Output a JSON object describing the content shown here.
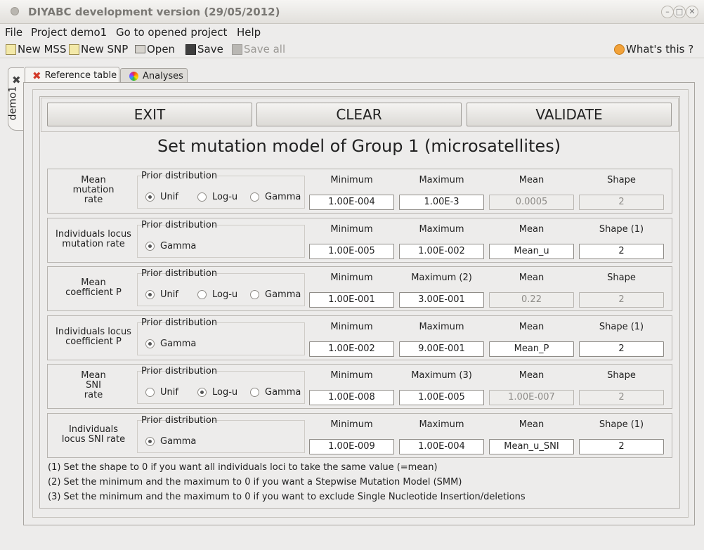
{
  "window": {
    "title": "DIYABC development version  (29/05/2012)"
  },
  "menu": [
    "File",
    "Project demo1",
    "Go to opened project",
    "Help"
  ],
  "toolbar": {
    "new_mss": "New MSS",
    "new_snp": "New SNP",
    "open": "Open",
    "save": "Save",
    "save_all": "Save all",
    "whats_this": "What's this ?"
  },
  "sidetab": {
    "label": "demo1"
  },
  "tabs": {
    "reference": "Reference table",
    "analyses": "Analyses"
  },
  "buttons": {
    "exit": "EXIT",
    "clear": "CLEAR",
    "validate": "VALIDATE"
  },
  "heading": "Set mutation model of Group 1 (microsatellites)",
  "prior_label": "Prior distribution",
  "rows": [
    {
      "label": "Mean\nmutation\nrate",
      "radios": [
        {
          "label": "Unif",
          "on": true
        },
        {
          "label": "Log-u",
          "on": false
        },
        {
          "label": "Gamma",
          "on": false
        }
      ],
      "cols": [
        "Minimum",
        "Maximum",
        "Mean",
        "Shape"
      ],
      "values": [
        "1.00E-004",
        "1.00E-3",
        "0.0005",
        "2"
      ],
      "disabled": [
        false,
        false,
        true,
        true
      ]
    },
    {
      "label": "Individuals locus\nmutation rate",
      "radios": [
        {
          "label": "Gamma",
          "on": true
        }
      ],
      "cols": [
        "Minimum",
        "Maximum",
        "Mean",
        "Shape (1)"
      ],
      "values": [
        "1.00E-005",
        "1.00E-002",
        "Mean_u",
        "2"
      ],
      "disabled": [
        false,
        false,
        false,
        false
      ]
    },
    {
      "label": "Mean\ncoefficient P",
      "radios": [
        {
          "label": "Unif",
          "on": true
        },
        {
          "label": "Log-u",
          "on": false
        },
        {
          "label": "Gamma",
          "on": false
        }
      ],
      "cols": [
        "Minimum",
        "Maximum (2)",
        "Mean",
        "Shape"
      ],
      "values": [
        "1.00E-001",
        "3.00E-001",
        "0.22",
        "2"
      ],
      "disabled": [
        false,
        false,
        true,
        true
      ]
    },
    {
      "label": "Individuals locus\ncoefficient P",
      "radios": [
        {
          "label": "Gamma",
          "on": true
        }
      ],
      "cols": [
        "Minimum",
        "Maximum",
        "Mean",
        "Shape (1)"
      ],
      "values": [
        "1.00E-002",
        "9.00E-001",
        "Mean_P",
        "2"
      ],
      "disabled": [
        false,
        false,
        false,
        false
      ]
    },
    {
      "label": "Mean\nSNI\nrate",
      "radios": [
        {
          "label": "Unif",
          "on": false
        },
        {
          "label": "Log-u",
          "on": true
        },
        {
          "label": "Gamma",
          "on": false
        }
      ],
      "cols": [
        "Minimum",
        "Maximum (3)",
        "Mean",
        "Shape"
      ],
      "values": [
        "1.00E-008",
        "1.00E-005",
        "1.00E-007",
        "2"
      ],
      "disabled": [
        false,
        false,
        true,
        true
      ]
    },
    {
      "label": "Individuals\nlocus SNI rate",
      "radios": [
        {
          "label": "Gamma",
          "on": true
        }
      ],
      "cols": [
        "Minimum",
        "Maximum",
        "Mean",
        "Shape (1)"
      ],
      "values": [
        "1.00E-009",
        "1.00E-004",
        "Mean_u_SNI",
        "2"
      ],
      "disabled": [
        false,
        false,
        false,
        false
      ]
    }
  ],
  "notes": [
    "(1) Set the shape to 0 if you want all individuals loci to take the same value (=mean)",
    "(2) Set the minimum and the maximum to 0 if you want a Stepwise Mutation Model (SMM)",
    "(3) Set the minimum and the maximum to 0 if you want to exclude Single Nucleotide Insertion/deletions"
  ]
}
